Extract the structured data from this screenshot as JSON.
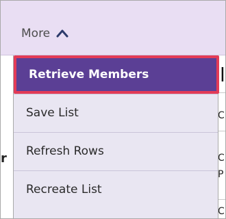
{
  "header": {
    "more_label": "More"
  },
  "menu": {
    "items": [
      {
        "label": "Retrieve Members",
        "active": true
      },
      {
        "label": "Save List",
        "active": false
      },
      {
        "label": "Refresh Rows",
        "active": false
      },
      {
        "label": "Recreate List",
        "active": false
      }
    ]
  },
  "background": {
    "right_chars": [
      "l",
      "C",
      "C",
      "P",
      "C"
    ],
    "left_char": "r"
  },
  "colors": {
    "header_bg": "#e9def3",
    "menu_bg": "#e9e6f2",
    "active_bg": "#5b3f95",
    "active_border": "#e33b57"
  },
  "icons": {
    "more_chevron": "chevron-up-icon"
  }
}
